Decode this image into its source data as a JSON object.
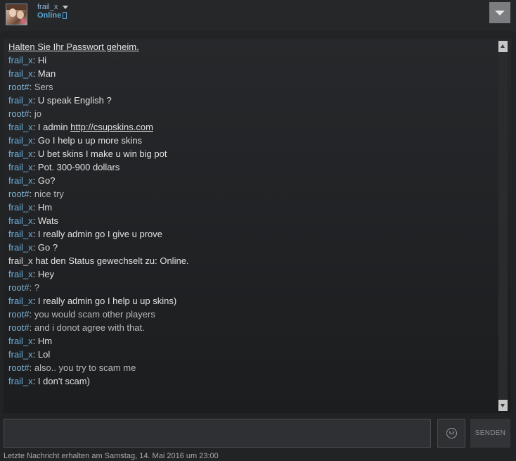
{
  "header": {
    "username": "frail_x",
    "status": "Online"
  },
  "messages": [
    {
      "type": "warning",
      "text": "Halten Sie Ihr Passwort geheim."
    },
    {
      "type": "msg",
      "sender": "frail_x",
      "text": "Hi"
    },
    {
      "type": "msg",
      "sender": "frail_x",
      "text": "Man"
    },
    {
      "type": "msg",
      "sender": "root#",
      "text": "Sers"
    },
    {
      "type": "msg",
      "sender": "frail_x",
      "text": "U speak English ?"
    },
    {
      "type": "msg",
      "sender": "root#",
      "text": "jo"
    },
    {
      "type": "msg",
      "sender": "frail_x",
      "text": "I admin ",
      "link": "http://csupskins.com"
    },
    {
      "type": "msg",
      "sender": "frail_x",
      "text": "Go I help u up more skins"
    },
    {
      "type": "msg",
      "sender": "frail_x",
      "text": "U bet skins I make u win big pot"
    },
    {
      "type": "msg",
      "sender": "frail_x",
      "text": "Pot. 300-900 dollars"
    },
    {
      "type": "msg",
      "sender": "frail_x",
      "text": "Go?"
    },
    {
      "type": "msg",
      "sender": "root#",
      "text": "nice try"
    },
    {
      "type": "msg",
      "sender": "frail_x",
      "text": "Hm"
    },
    {
      "type": "msg",
      "sender": "frail_x",
      "text": "Wats"
    },
    {
      "type": "msg",
      "sender": "frail_x",
      "text": "I really admin go I give u prove"
    },
    {
      "type": "msg",
      "sender": "frail_x",
      "text": "Go ?"
    },
    {
      "type": "status",
      "text": "frail_x hat den Status gewechselt zu: Online."
    },
    {
      "type": "msg",
      "sender": "frail_x",
      "text": "Hey"
    },
    {
      "type": "msg",
      "sender": "root#",
      "text": "?"
    },
    {
      "type": "msg",
      "sender": "frail_x",
      "text": "I really admin go I help u up skins)"
    },
    {
      "type": "msg",
      "sender": "root#",
      "text": "you would scam other players"
    },
    {
      "type": "msg",
      "sender": "root#",
      "text": "and i donot agree with that."
    },
    {
      "type": "msg",
      "sender": "frail_x",
      "text": "Hm"
    },
    {
      "type": "msg",
      "sender": "frail_x",
      "text": "Lol"
    },
    {
      "type": "msg",
      "sender": "root#",
      "text": "also.. you try to scam me"
    },
    {
      "type": "msg",
      "sender": "frail_x",
      "text": "I don't scam)"
    }
  ],
  "composer": {
    "input_value": "",
    "send_label": "SENDEN"
  },
  "footer": {
    "last_message": "Letzte Nachricht erhalten am Samstag, 14. Mai 2016 um 23:00"
  },
  "icons": {
    "avatar": "user-avatar",
    "dropdown": "chevron-down-icon",
    "mobile": "phone-icon",
    "menu": "menu-dropdown-icon",
    "emoji": "smiley-icon"
  },
  "colors": {
    "frail_name": "#6fb2df",
    "root_name": "#7fb4d6",
    "status_online": "#57a9d6"
  }
}
